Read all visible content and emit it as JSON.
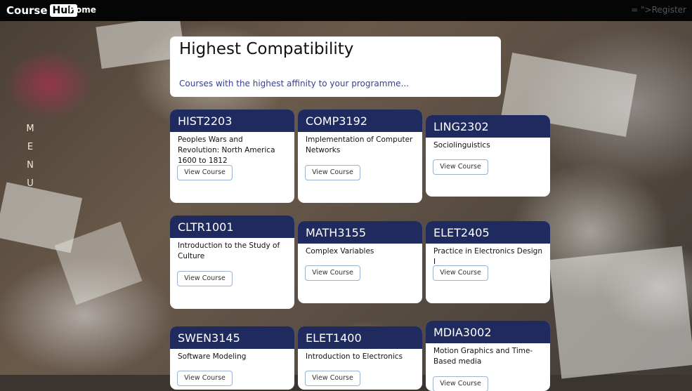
{
  "navbar": {
    "logo_course": "Course",
    "logo_hub": "Hub",
    "home": "Home",
    "register": "= \">Register"
  },
  "side_menu": [
    "M",
    "E",
    "N",
    "U"
  ],
  "hero": {
    "title": "Highest Compatibility",
    "subtitle": "Courses with the highest affinity to your programme..."
  },
  "courses": [
    {
      "code": "HIST2203",
      "title": "Peoples Wars and Revolution: North America 1600 to 1812",
      "button": "View Course"
    },
    {
      "code": "COMP3192",
      "title": "Implementation of Computer Networks",
      "button": "View Course"
    },
    {
      "code": "LING2302",
      "title": "Sociolinguistics",
      "button": "View Course"
    },
    {
      "code": "CLTR1001",
      "title": "Introduction to the Study of Culture",
      "button": "View Course"
    },
    {
      "code": "MATH3155",
      "title": "Complex Variables",
      "button": "View Course"
    },
    {
      "code": "ELET2405",
      "title": "Practice in Electronics Design I",
      "button": "View Course"
    },
    {
      "code": "SWEN3145",
      "title": "Software Modeling",
      "button": "View Course"
    },
    {
      "code": "ELET1400",
      "title": "Introduction to Electronics",
      "button": "View Course"
    },
    {
      "code": "MDIA3002",
      "title": "Motion Graphics and Time-Based media",
      "button": "View Course"
    }
  ]
}
